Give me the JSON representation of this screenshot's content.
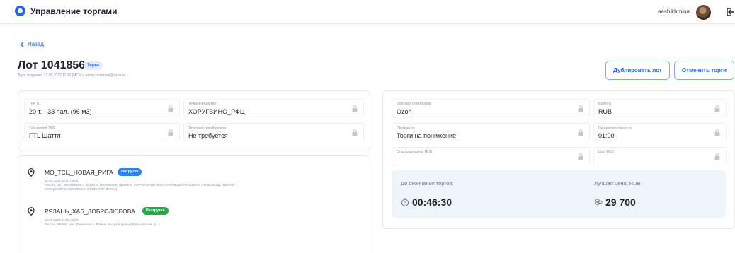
{
  "header": {
    "app_title": "Управление торгами",
    "username": "aashikhmina"
  },
  "nav": {
    "back_label": "Назад"
  },
  "lot": {
    "title": "Лот 1041856",
    "badge": "Торги",
    "meta": "Дата создания: 12.05.2023 11:10 (МСК) • Автор: example@ozon.ru"
  },
  "actions": {
    "duplicate_label": "Дублировать лот",
    "cancel_label": "Отменить торги"
  },
  "transport": {
    "vehicle_type": {
      "label": "Тип ТС",
      "value": "20 т. - 33 пал. (96 м3)"
    },
    "initiator_point": {
      "label": "Точка-инициатор",
      "value": "ХОРУГВИНО_РФЦ"
    },
    "tms_request_type": {
      "label": "Тип заявки TMS",
      "value": "FTL Шаттл"
    },
    "temperature_mode": {
      "label": "Температурный режим",
      "value": "Не требуется"
    }
  },
  "route": [
    {
      "name": "МО_ТСЦ_НОВАЯ_РИГА",
      "badge": "Погрузка",
      "badge_color": "#2f80ed",
      "datetime": "12.05.2023 18:00 (МСК)",
      "address_line1": "Россия, обл. Московская, г. Истра, с. Петровское, здание 2, ТЕРРИТОРИЯ МНОГОФУНКЦИОНАЛЬНОГО ПРОИЗВОДСТВЕННО-",
      "address_line2": "СКЛАДСКОГО КОМПЛЕКСА ОРИЕНТИР-ЗАПАД"
    },
    {
      "name": "РЯЗАНЬ_ХАБ_ДОБРОЛЮБОВА",
      "badge": "Разгрузка",
      "badge_color": "#27a843",
      "datetime": "15.05.2023 02:00 (МСК)",
      "address_line1": "Россия, 390047, обл. Рязанская, г. Рязань, пр-д 4-й проезд Добролюбова, д. 1",
      "address_line2": ""
    }
  ],
  "trading": {
    "platform": {
      "label": "Торговая платформа",
      "value": "Ozon"
    },
    "currency": {
      "label": "Валюта",
      "value": "RUB"
    },
    "procedure": {
      "label": "Процедура",
      "value": "Торги на понижение"
    },
    "duration": {
      "label": "Продолжительность",
      "value": "01:00"
    },
    "start_price": {
      "label": "Стартовая цена, RUB",
      "value": ""
    },
    "step": {
      "label": "Шаг, RUB",
      "value": ""
    }
  },
  "auction": {
    "time_left_label": "До окончания торгов:",
    "time_left": "00:46:30",
    "best_price_label": "Лучшая цена, RUB",
    "best_price": "29 700"
  },
  "colors": {
    "accent": "#1f66e5",
    "load": "#2f80ed",
    "unload": "#27a843"
  }
}
